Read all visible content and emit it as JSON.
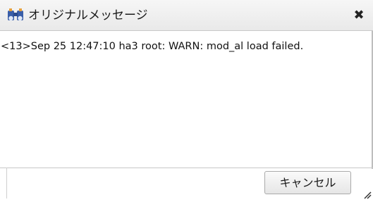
{
  "dialog": {
    "title": "オリジナルメッセージ",
    "close_symbol": "✖",
    "title_icon": "binoculars-icon",
    "message": "<13>Sep 25 12:47:10 ha3 root: WARN: mod_al load failed.",
    "cancel_label": "キャンセル"
  },
  "colors": {
    "icon_blue": "#3a5ea8",
    "icon_orange": "#e8a13a"
  }
}
